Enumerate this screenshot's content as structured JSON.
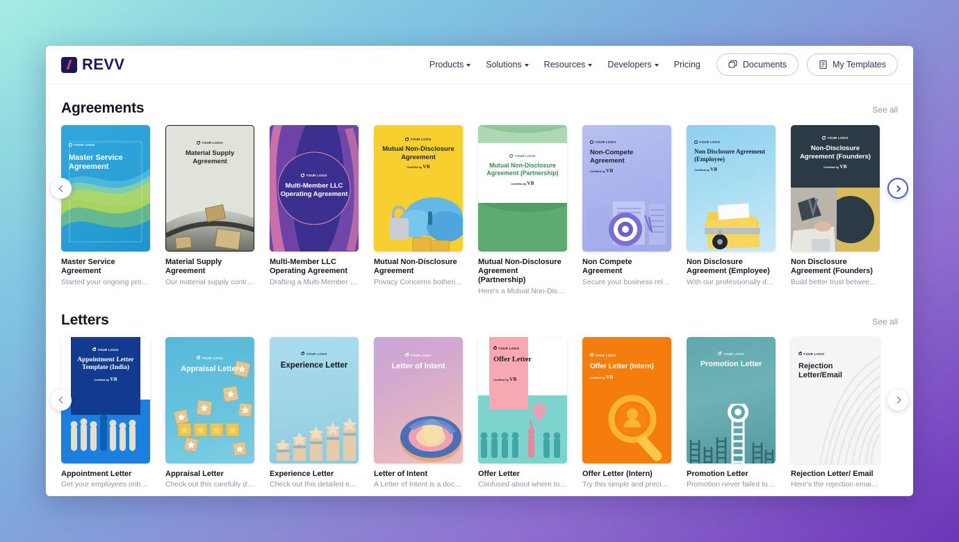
{
  "brand": {
    "name": "REVV",
    "mark": "slash-logo"
  },
  "nav": {
    "links": [
      {
        "label": "Products",
        "has_caret": true
      },
      {
        "label": "Solutions",
        "has_caret": true
      },
      {
        "label": "Resources",
        "has_caret": true
      },
      {
        "label": "Developers",
        "has_caret": true
      },
      {
        "label": "Pricing",
        "has_caret": false
      }
    ],
    "buttons": [
      {
        "label": "Documents",
        "icon": "documents-icon"
      },
      {
        "label": "My Templates",
        "icon": "template-icon"
      }
    ]
  },
  "sections": [
    {
      "title": "Agreements",
      "see_all": "See all",
      "prev_label": "‹",
      "next_label": "›",
      "cards": [
        {
          "title": "Master Service Agreement",
          "desc": "Started your ongoing projec...",
          "thumb_title": "Master Service Agreement",
          "logo": "YOUR LOGO",
          "certified": ""
        },
        {
          "title": "Material Supply Agreement",
          "desc": "Our material supply contrac...",
          "thumb_title": "Material Supply Agreement",
          "logo": "YOUR LOGO",
          "certified": ""
        },
        {
          "title": "Multi-Member LLC Operating Agreement",
          "desc": "Drafting a Multi-Member LL...",
          "thumb_title": "Multi-Member LLC Operating Agreement",
          "logo": "YOUR LOGO",
          "certified": ""
        },
        {
          "title": "Mutual Non-Disclosure Agreement",
          "desc": "Privacy Concerns bothering ...",
          "thumb_title": "Mutual Non-Disclosure Agreement",
          "logo": "YOUR LOGO",
          "certified": "Certified by"
        },
        {
          "title": "Mutual Non-Disclosure Agreement (Partnership)",
          "desc": "Here's a Mutual Non-Disclo...",
          "thumb_title": "Mutual Non-Disclosure Agreement (Partnership)",
          "logo": "YOUR LOGO",
          "certified": "Certified by"
        },
        {
          "title": "Non Compete Agreement",
          "desc": "Secure your business relati...",
          "thumb_title": "Non-Compete Agreement",
          "logo": "YOUR LOGO",
          "certified": "Certified by"
        },
        {
          "title": "Non Disclosure Agreement (Employee)",
          "desc": "With our professionally des...",
          "thumb_title": "Non Disclosure Agreement (Employee)",
          "logo": "YOUR LOGO",
          "certified": "Certified by"
        },
        {
          "title": "Non Disclosure Agreement (Founders)",
          "desc": "Build better trust between f...",
          "thumb_title": "Non-Disclosure Agreement (Founders)",
          "logo": "YOUR LOGO",
          "certified": "Certified by"
        }
      ]
    },
    {
      "title": "Letters",
      "see_all": "See all",
      "prev_label": "‹",
      "next_label": "›",
      "cards": [
        {
          "title": "Appointment Letter",
          "desc": "Get your employees onboar...",
          "thumb_title": "Appointment Letter Template (India)",
          "logo": "YOUR LOGO",
          "certified": "Certified by"
        },
        {
          "title": "Appraisal Letter",
          "desc": "Check out this carefully draf...",
          "thumb_title": "Appraisal Letter",
          "logo": "YOUR LOGO",
          "certified": ""
        },
        {
          "title": "Experience Letter",
          "desc": "Check out this detailed exp...",
          "thumb_title": "Experience Letter",
          "logo": "YOUR LOGO",
          "certified": ""
        },
        {
          "title": "Letter of Intent",
          "desc": "A Letter of Intent is a docu...",
          "thumb_title": "Letter of Intent",
          "logo": "YOUR LOGO",
          "certified": ""
        },
        {
          "title": "Offer Letter",
          "desc": "Confused about where to fi...",
          "thumb_title": "Offer Letter",
          "logo": "YOUR LOGO",
          "certified": "Certified by"
        },
        {
          "title": "Offer Letter (Intern)",
          "desc": "Try this simple and precise ...",
          "thumb_title": "Offer Letter (Intern)",
          "logo": "YOUR LOGO",
          "certified": "Certified by"
        },
        {
          "title": "Promotion Letter",
          "desc": "Promotion never failed to m...",
          "thumb_title": "Promotion Letter",
          "logo": "YOUR LOGO",
          "certified": ""
        },
        {
          "title": "Rejection Letter/ Email",
          "desc": "Here's the rejection email te...",
          "thumb_title": "Rejection Letter/Email",
          "logo": "YOUR LOGO",
          "certified": ""
        }
      ]
    }
  ],
  "colors": {
    "brand_navy": "#17195b",
    "brand_accent": "#e8456d",
    "arrow_active": "#3b5bdb",
    "muted_text": "#8e95ab"
  }
}
